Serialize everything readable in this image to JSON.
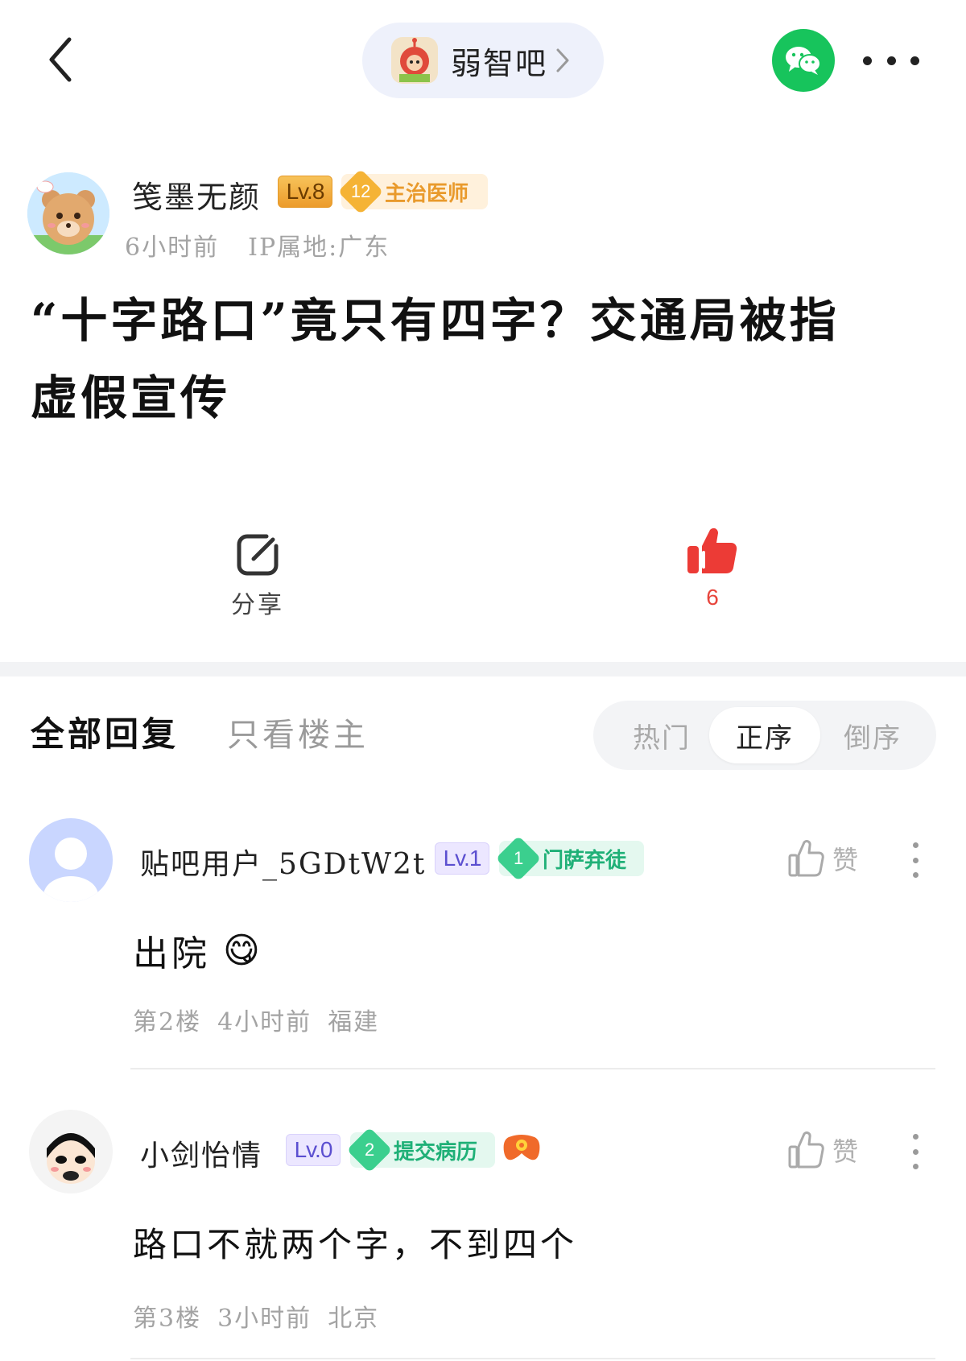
{
  "header": {
    "forum_name": "弱智吧",
    "back_icon": "chevron-left-icon",
    "share_icon": "wechat-icon",
    "more_icon": "more-horizontal-icon"
  },
  "post": {
    "author": {
      "name": "笺墨无颜",
      "level": "Lv.8",
      "title_level": "12",
      "title": "主治医师"
    },
    "time": "6小时前",
    "ip": "IP属地:广东",
    "title_line1": "“十字路口”竟只有四字？交通局被指",
    "title_line2": "虚假宣传",
    "share_label": "分享",
    "like_count": "6"
  },
  "tabs": {
    "all": "全部回复",
    "op_only": "只看楼主"
  },
  "sort": {
    "hot": "热门",
    "asc": "正序",
    "desc": "倒序",
    "selected": "正序"
  },
  "comments": [
    {
      "name": "贴吧用户_5GDtW2t",
      "level": "Lv.1",
      "title_level": "1",
      "title": "门萨弃徒",
      "text": "出院",
      "emoji": "😋",
      "floor": "第2楼",
      "time": "4小时前",
      "location": "福建",
      "like_label": "赞"
    },
    {
      "name": "小剑怡情",
      "level": "Lv.0",
      "title_level": "2",
      "title": "提交病历",
      "text": "路口不就两个字，不到四个",
      "floor": "第3楼",
      "time": "3小时前",
      "location": "北京",
      "like_label": "赞"
    }
  ],
  "colors": {
    "accent_red": "#e7453c",
    "wechat_green": "#17c45c",
    "level_gold": "#ec9b2b",
    "title_green": "#1fb077",
    "level_purple": "#5b4fd0"
  }
}
